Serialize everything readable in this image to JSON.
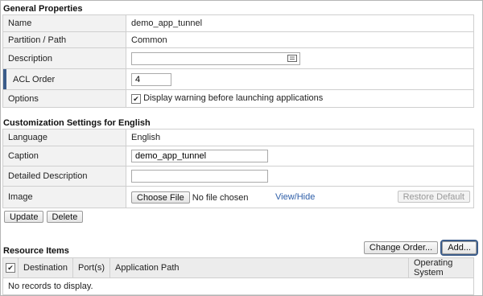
{
  "general": {
    "title": "General Properties",
    "name_label": "Name",
    "name_value": "demo_app_tunnel",
    "partition_label": "Partition / Path",
    "partition_value": "Common",
    "description_label": "Description",
    "description_value": "",
    "acl_label": "ACL Order",
    "acl_value": "4",
    "options_label": "Options",
    "options_checkbox": "Display warning before launching applications",
    "options_checked": true
  },
  "customization": {
    "title": "Customization Settings for English",
    "language_label": "Language",
    "language_value": "English",
    "caption_label": "Caption",
    "caption_value": "demo_app_tunnel",
    "detailed_label": "Detailed Description",
    "detailed_value": "",
    "image_label": "Image",
    "choose_file": "Choose File",
    "no_file": "No file chosen",
    "view_hide": "View/Hide",
    "restore_default": "Restore Default"
  },
  "actions": {
    "update": "Update",
    "delete": "Delete"
  },
  "resources": {
    "title": "Resource Items",
    "change_order": "Change Order...",
    "add": "Add...",
    "columns": [
      "Destination",
      "Port(s)",
      "Application Path",
      "Operating System"
    ],
    "empty": "No records to display."
  }
}
